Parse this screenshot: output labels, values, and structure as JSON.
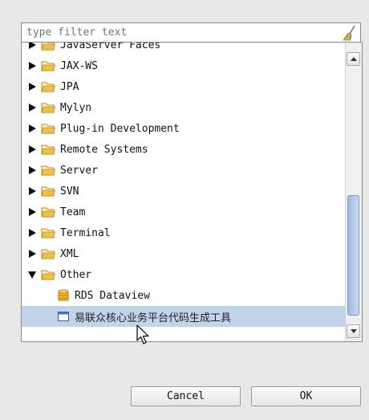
{
  "filter": {
    "placeholder": "type filter text",
    "value": ""
  },
  "tree": {
    "items": [
      {
        "label": "JavaServer Faces",
        "expanded": false
      },
      {
        "label": "JAX-WS",
        "expanded": false
      },
      {
        "label": "JPA",
        "expanded": false
      },
      {
        "label": "Mylyn",
        "expanded": false
      },
      {
        "label": "Plug-in Development",
        "expanded": false
      },
      {
        "label": "Remote Systems",
        "expanded": false
      },
      {
        "label": "Server",
        "expanded": false
      },
      {
        "label": "SVN",
        "expanded": false
      },
      {
        "label": "Team",
        "expanded": false
      },
      {
        "label": "Terminal",
        "expanded": false
      },
      {
        "label": "XML",
        "expanded": false
      },
      {
        "label": "Other",
        "expanded": true
      }
    ],
    "children": [
      {
        "label": "RDS Dataview",
        "icon": "database-icon"
      },
      {
        "label": "易联众核心业务平台代码生成工具",
        "icon": "window-icon",
        "selected": true
      }
    ]
  },
  "buttons": {
    "cancel": "Cancel",
    "ok": "OK"
  },
  "colors": {
    "selection": "#c2d4ea",
    "folder": "#f0c048",
    "scroll_thumb": "#aec4e6"
  }
}
